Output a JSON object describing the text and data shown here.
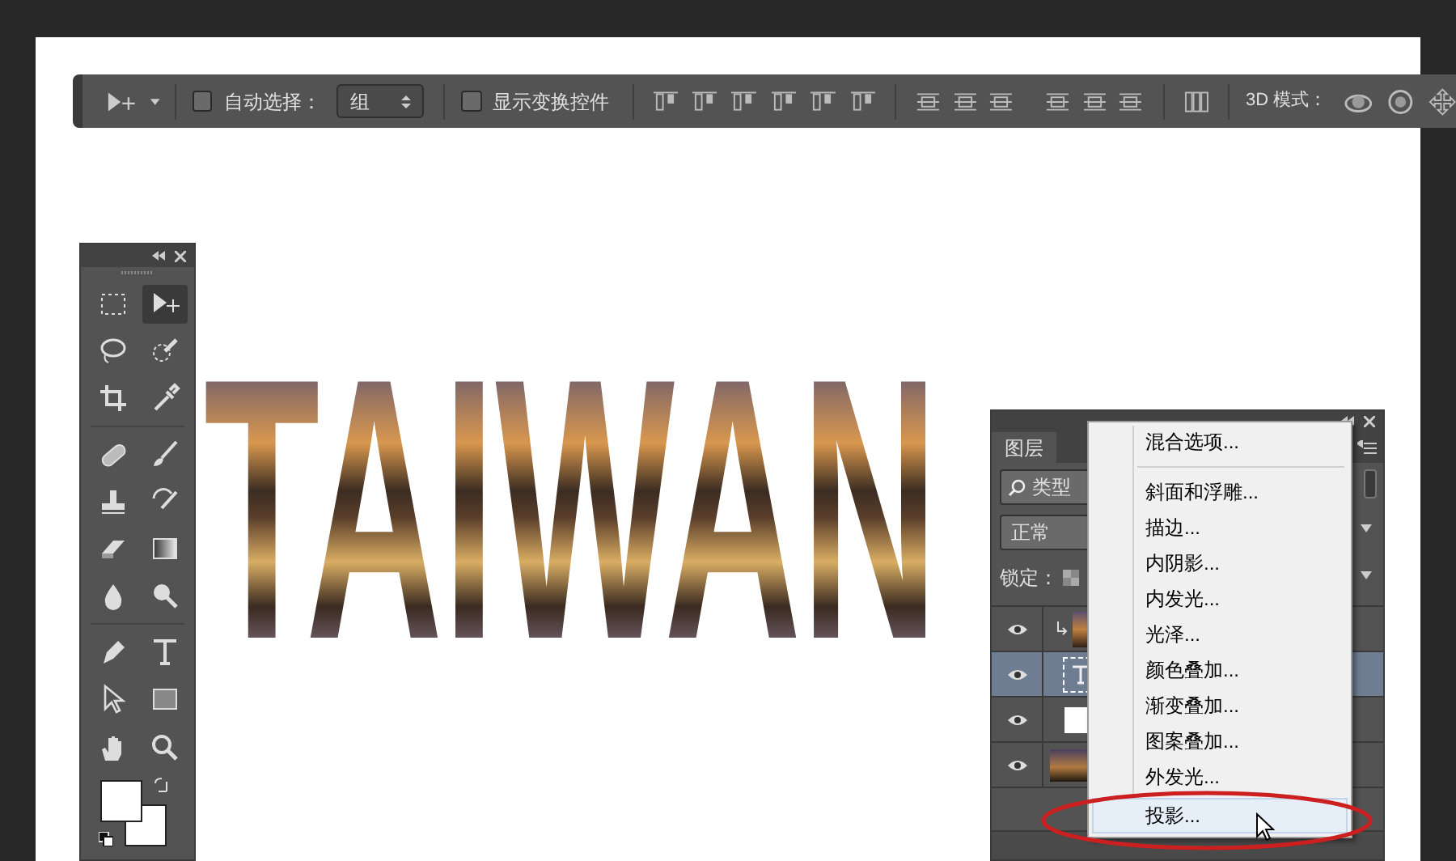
{
  "options_bar": {
    "auto_select": {
      "label": "自动选择：",
      "checked": false
    },
    "auto_select_target": {
      "value": "组"
    },
    "show_transform": {
      "label": "显示变换控件",
      "checked": false
    },
    "mode_label": "3D 模式："
  },
  "document": {
    "text": "TAIWAN"
  },
  "toolbox": {
    "tools": [
      {
        "selected": false
      },
      {
        "selected": true
      },
      {
        "selected": false
      },
      {
        "selected": false
      },
      {
        "selected": false
      },
      {
        "selected": false
      },
      {
        "selected": false
      },
      {
        "selected": false
      },
      {
        "selected": false
      },
      {
        "selected": false
      },
      {
        "selected": false
      },
      {
        "selected": false
      },
      {
        "selected": false
      },
      {
        "selected": false
      },
      {
        "selected": false
      },
      {
        "selected": false
      },
      {
        "selected": false
      },
      {
        "selected": false
      }
    ]
  },
  "layers_panel": {
    "tab": "图层",
    "filter": "类型",
    "blend_mode": "正常",
    "lock_label": "锁定：",
    "layers": [
      {
        "kind": "clipped-image",
        "visible": true,
        "selected": false
      },
      {
        "kind": "text",
        "visible": true,
        "selected": true
      },
      {
        "kind": "fill",
        "visible": true,
        "selected": false
      },
      {
        "kind": "image",
        "visible": true,
        "selected": false
      }
    ]
  },
  "context_menu": {
    "items": [
      {
        "label": "混合选项...",
        "selected": false
      },
      {
        "label": "斜面和浮雕...",
        "selected": false
      },
      {
        "label": "描边...",
        "selected": false
      },
      {
        "label": "内阴影...",
        "selected": false
      },
      {
        "label": "内发光...",
        "selected": false
      },
      {
        "label": "光泽...",
        "selected": false
      },
      {
        "label": "颜色叠加...",
        "selected": false
      },
      {
        "label": "渐变叠加...",
        "selected": false
      },
      {
        "label": "图案叠加...",
        "selected": false
      },
      {
        "label": "外发光...",
        "selected": false
      },
      {
        "label": "投影...",
        "selected": true
      }
    ]
  }
}
